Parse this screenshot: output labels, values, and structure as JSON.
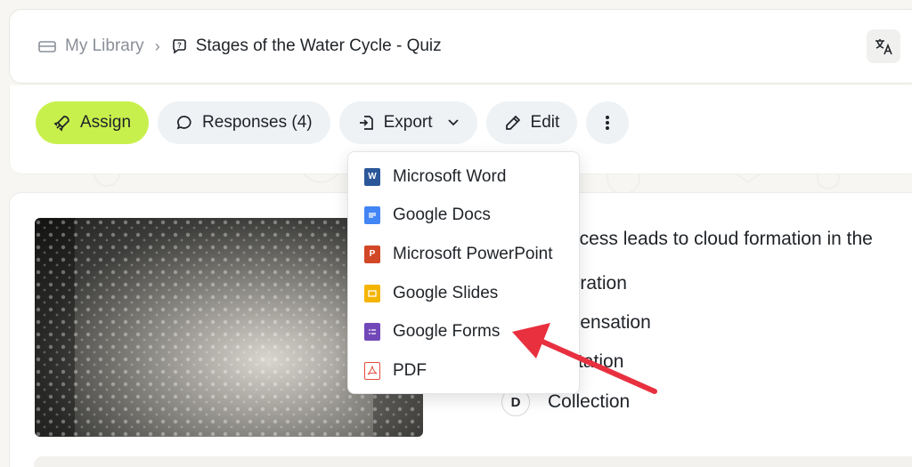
{
  "breadcrumb": {
    "library": "My Library",
    "separator": "›",
    "title": "Stages of the Water Cycle - Quiz"
  },
  "toolbar": {
    "assign": "Assign",
    "responses": "Responses (4)",
    "export": "Export",
    "edit": "Edit"
  },
  "export_menu": {
    "items": [
      {
        "label": "Microsoft Word",
        "icon": "word-icon",
        "color": "#2b579a"
      },
      {
        "label": "Google Docs",
        "icon": "google-docs-icon",
        "color": "#4285f4"
      },
      {
        "label": "Microsoft PowerPoint",
        "icon": "powerpoint-icon",
        "color": "#d24726"
      },
      {
        "label": "Google Slides",
        "icon": "google-slides-icon",
        "color": "#f4b400"
      },
      {
        "label": "Google Forms",
        "icon": "google-forms-icon",
        "color": "#7248b9"
      },
      {
        "label": "PDF",
        "icon": "pdf-icon",
        "color": "#e44b3c"
      }
    ]
  },
  "question": {
    "text": "ocess leads to cloud formation in the",
    "options": [
      {
        "letter": "",
        "text": "poration"
      },
      {
        "letter": "",
        "text": "ndensation"
      },
      {
        "letter": "",
        "text": "ipitation"
      },
      {
        "letter": "D",
        "text": "Collection"
      }
    ]
  },
  "colors": {
    "accent": "#c8f04d",
    "button_bg": "#eef2f5",
    "annotation": "#e8303f"
  }
}
